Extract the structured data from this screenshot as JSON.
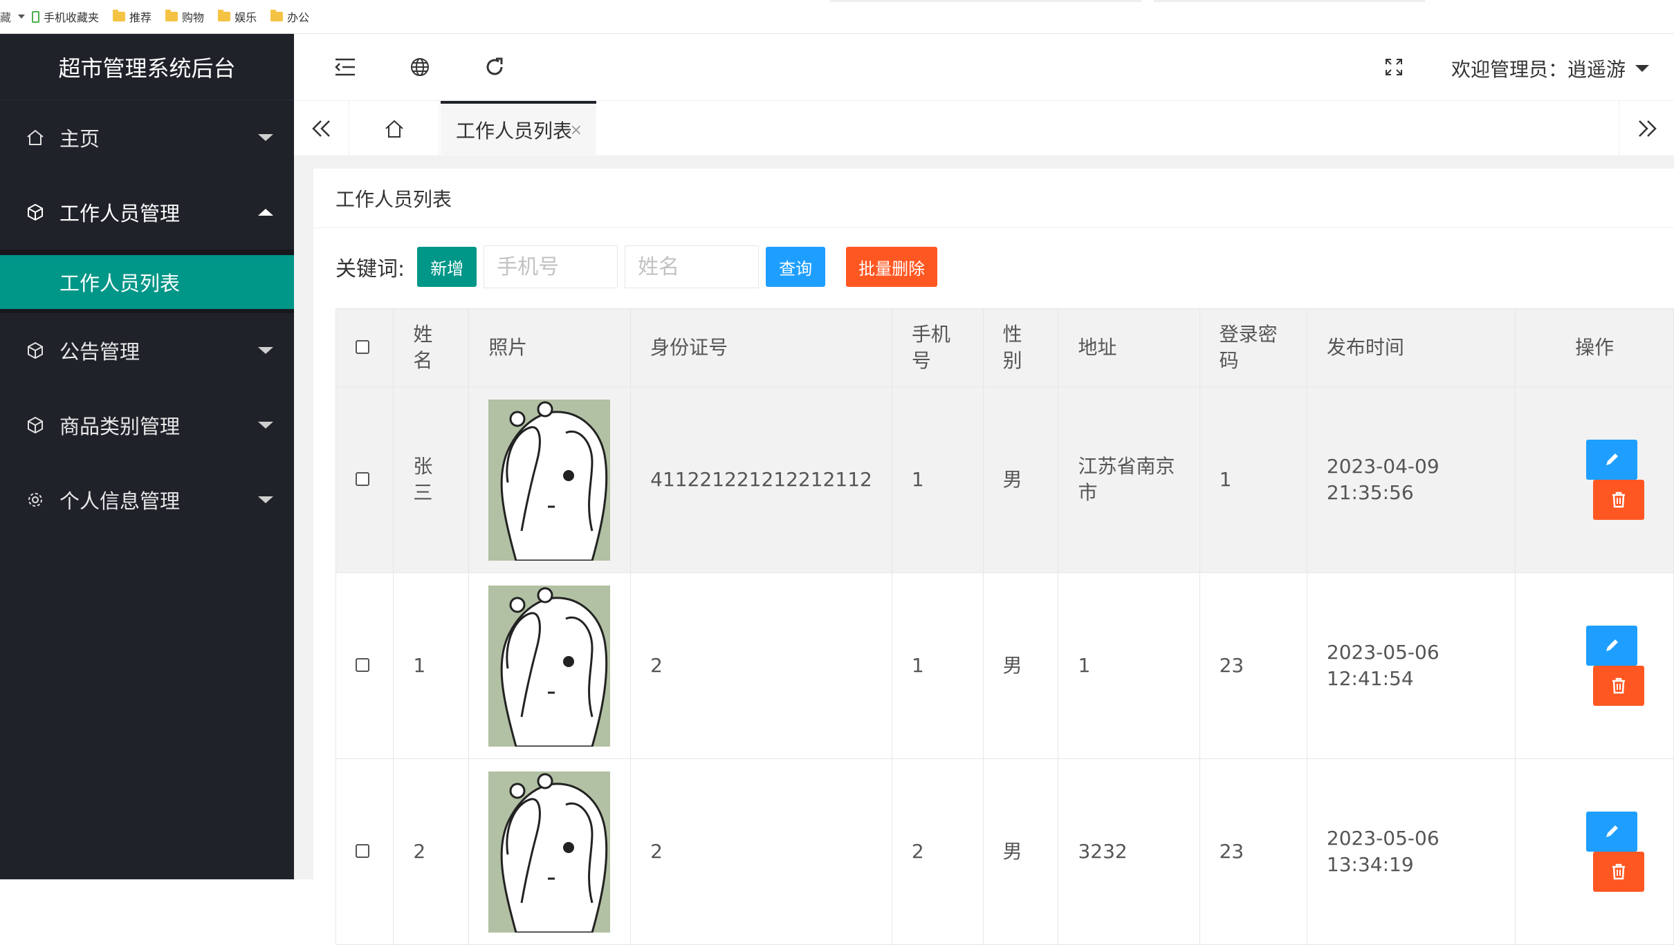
{
  "bookmarks": [
    "手机收藏夹",
    "推荐",
    "购物",
    "娱乐",
    "办公"
  ],
  "bookmarks_left_fragment": "藏",
  "sidebar": {
    "title": "超市管理系统后台",
    "items": [
      {
        "label": "主页",
        "icon": "home-icon"
      },
      {
        "label": "工作人员管理",
        "icon": "cube-icon",
        "open": true,
        "sub": [
          "工作人员列表"
        ]
      },
      {
        "label": "公告管理",
        "icon": "cube-icon"
      },
      {
        "label": "商品类别管理",
        "icon": "cube-icon"
      },
      {
        "label": "个人信息管理",
        "icon": "gear-icon"
      }
    ]
  },
  "header": {
    "welcome": "欢迎管理员：逍遥游",
    "icons": [
      "menu-fold-icon",
      "globe-icon",
      "refresh-icon",
      "fullscreen-icon"
    ]
  },
  "tabs": {
    "active": "工作人员列表",
    "close": "×"
  },
  "panel": {
    "title": "工作人员列表"
  },
  "search": {
    "keyword_label": "关键词:",
    "add_label": "新增",
    "phone_placeholder": "手机号",
    "name_placeholder": "姓名",
    "query_label": "查询",
    "batch_delete_label": "批量删除"
  },
  "table": {
    "headers": [
      "姓名",
      "照片",
      "身份证号",
      "手机号",
      "性别",
      "地址",
      "登录密码",
      "发布时间",
      "操作"
    ],
    "rows": [
      {
        "name": "张三",
        "id_no": "411221221212212112",
        "phone": "1",
        "gender": "男",
        "address": "江苏省南京市",
        "password": "1",
        "time": "2023-04-09 21:35:56"
      },
      {
        "name": "1",
        "id_no": "2",
        "phone": "1",
        "gender": "男",
        "address": "1",
        "password": "23",
        "time": "2023-05-06 12:41:54"
      },
      {
        "name": "2",
        "id_no": "2",
        "phone": "2",
        "gender": "男",
        "address": "3232",
        "password": "23",
        "time": "2023-05-06 13:34:19"
      }
    ]
  },
  "colors": {
    "sidebar_bg": "#20222a",
    "accent_green": "#009688",
    "blue": "#1e9fff",
    "red": "#ff5722"
  }
}
